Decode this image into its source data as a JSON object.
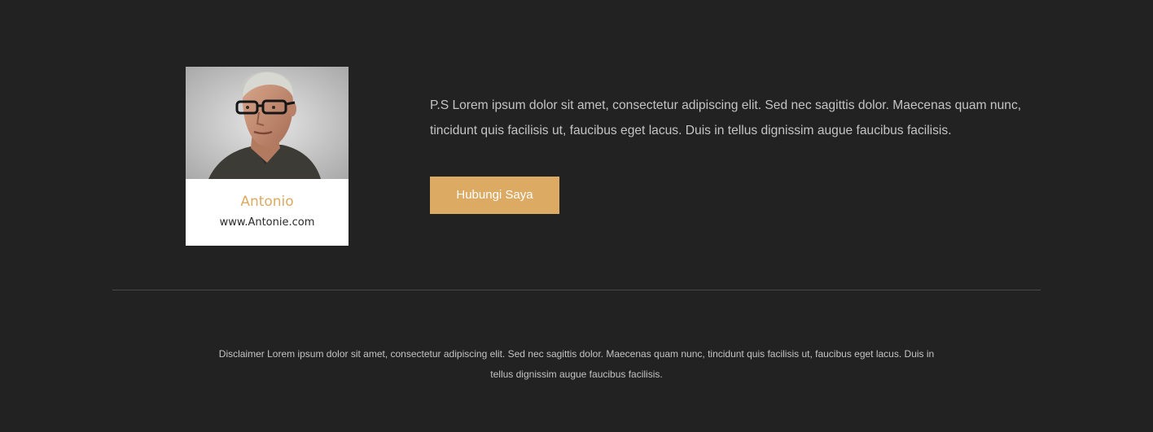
{
  "profile": {
    "name": "Antonio",
    "website": "www.Antonie.com",
    "photo_icon": "person-portrait-photo"
  },
  "message": {
    "text": "P.S Lorem ipsum dolor sit amet, consectetur adipiscing elit. Sed nec sagittis dolor. Maecenas quam nunc, tincidunt quis facilisis ut, faucibus eget lacus. Duis in tellus dignissim augue faucibus facilisis."
  },
  "cta": {
    "label": "Hubungi Saya"
  },
  "footer": {
    "disclaimer": "Disclaimer Lorem ipsum dolor sit amet, consectetur adipiscing elit. Sed nec sagittis dolor. Maecenas quam nunc, tincidunt quis facilisis ut, faucibus eget lacus. Duis in tellus dignissim augue faucibus facilisis."
  },
  "colors": {
    "background": "#222222",
    "accent": "#dcaa62",
    "body_text": "#c4c4c4",
    "card_background": "#ffffff",
    "divider": "#4a4a4a"
  }
}
